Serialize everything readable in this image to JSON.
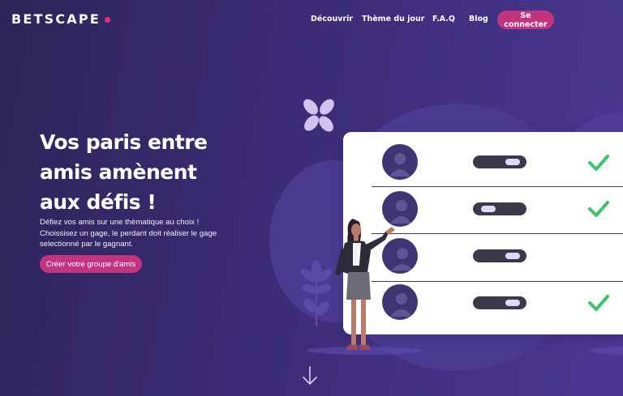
{
  "header": {
    "logo_text": "BETSCAPE",
    "nav": [
      {
        "label": "Découvrir"
      },
      {
        "label": "Thème du jour"
      },
      {
        "label": "F.A.Q"
      },
      {
        "label": "Blog"
      }
    ],
    "login_label": "Se connecter"
  },
  "hero": {
    "title_line1": "Vos paris entre",
    "title_line2": "amis amènent",
    "title_line3": "aux défis !",
    "desc_line1": "Défiez vos amis sur une thèmatique au choix !",
    "desc_line2": "Choissisez un gage, le perdant doit réaliser le gage",
    "desc_line3": "selectionné par le gagnant.",
    "cta_label": "Créer votre groupe d'amis"
  },
  "illustration": {
    "rows": [
      {
        "toggle_on": true,
        "checked": true
      },
      {
        "toggle_on": false,
        "checked": true
      },
      {
        "toggle_on": true,
        "checked": false
      },
      {
        "toggle_on": true,
        "checked": true
      }
    ]
  },
  "colors": {
    "accent": "#c3347f",
    "logo_dot": "#e8306e",
    "background_start": "#2e2458",
    "background_end": "#4a3893",
    "check_green": "#3cc36a"
  },
  "icons": {
    "scroll": "arrow-down-icon",
    "check": "check-icon",
    "avatar": "user-avatar-icon"
  }
}
